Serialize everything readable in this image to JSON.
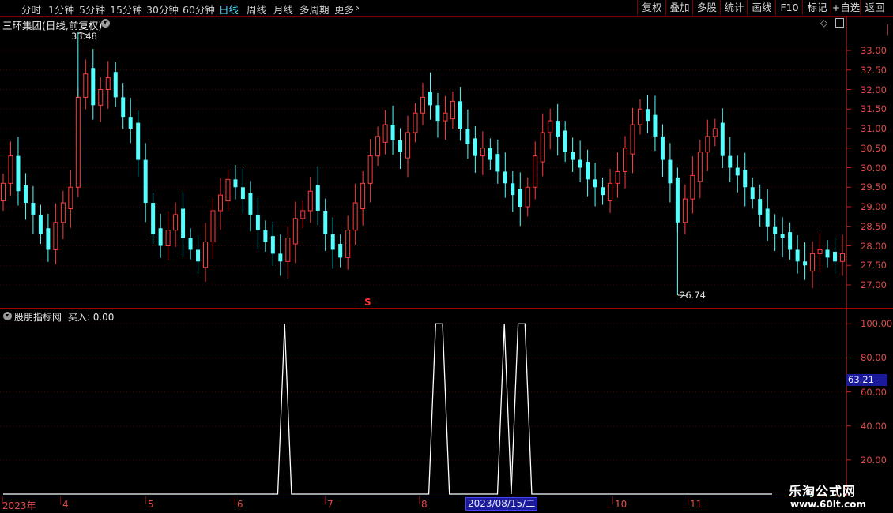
{
  "toolbar": {
    "periods": [
      "分时",
      "1分钟",
      "5分钟",
      "15分钟",
      "30分钟",
      "60分钟",
      "日线",
      "周线",
      "月线",
      "多周期",
      "更多"
    ],
    "active_period": "日线",
    "buttons": [
      "复权",
      "叠加",
      "多股",
      "统计",
      "画线",
      "F10",
      "标记",
      "+自选",
      "返回"
    ]
  },
  "main_chart": {
    "title": "三环集团(日线,前复权)",
    "high_label": "33.48",
    "low_label": "26.74",
    "signal_mark": "S"
  },
  "indicator": {
    "title": "股朋指标网",
    "buy_label": "买入: 0.00",
    "current_value": "63.21"
  },
  "x_axis": {
    "labels": [
      "2023年",
      "4",
      "5",
      "6",
      "7",
      "8",
      "9",
      "10",
      "11"
    ],
    "cursor_date": "2023/08/15/二"
  },
  "watermark": {
    "line1": "乐淘公式网",
    "line2": "www.60lt.com"
  },
  "colors": {
    "up": "#ff3c3c",
    "down": "#54ffff",
    "grid": "#8b0000",
    "axis_text": "#e04b4b",
    "active_tab": "#53e0ff"
  },
  "chart_data": [
    {
      "type": "candlestick",
      "title": "三环集团(日线,前复权)",
      "y_ticks": [
        27.0,
        27.5,
        28.0,
        28.5,
        29.0,
        29.5,
        30.0,
        30.5,
        31.0,
        31.5,
        32.0,
        32.5,
        33.0
      ],
      "ylim": [
        26.5,
        33.6
      ],
      "x_labels": [
        "2023年",
        "4",
        "5",
        "6",
        "7",
        "8",
        "9",
        "10",
        "11"
      ],
      "annotations": [
        {
          "label": "33.48",
          "value": 33.48
        },
        {
          "label": "26.74",
          "value": 26.74
        }
      ],
      "closes": [
        29.6,
        30.3,
        29.4,
        29.1,
        28.8,
        28.3,
        27.9,
        28.6,
        29.1,
        29.5,
        31.8,
        32.4,
        31.6,
        32.0,
        32.3,
        31.8,
        31.3,
        31.0,
        30.2,
        29.1,
        28.3,
        28.0,
        28.4,
        28.8,
        28.2,
        27.9,
        27.6,
        28.1,
        28.9,
        29.3,
        29.7,
        29.5,
        29.2,
        28.8,
        28.4,
        28.1,
        27.8,
        27.6,
        28.2,
        28.7,
        28.9,
        29.4,
        28.9,
        28.3,
        27.9,
        27.7,
        28.4,
        29.1,
        29.6,
        30.3,
        30.8,
        31.1,
        30.7,
        30.4,
        30.9,
        31.4,
        31.8,
        31.6,
        31.2,
        31.4,
        31.7,
        31.0,
        30.6,
        30.3,
        30.5,
        30.2,
        29.9,
        29.6,
        29.3,
        29.0,
        29.5,
        30.3,
        30.9,
        31.2,
        30.8,
        30.4,
        30.2,
        30.0,
        29.7,
        29.5,
        29.3,
        29.6,
        29.9,
        30.5,
        31.1,
        31.5,
        31.2,
        30.8,
        30.2,
        29.6,
        28.6,
        29.2,
        29.8,
        30.4,
        30.8,
        31.0,
        30.3,
        30.0,
        29.8,
        29.5,
        29.2,
        28.8,
        28.5,
        28.3,
        28.2,
        27.9,
        27.6,
        27.5,
        27.8,
        27.9,
        27.7,
        27.6,
        27.8
      ]
    },
    {
      "type": "line",
      "title": "股朋指标网",
      "y_ticks": [
        20.0,
        40.0,
        60.0,
        80.0,
        100.0
      ],
      "ylim": [
        0,
        105
      ],
      "series": [
        {
          "name": "买入",
          "values": [
            0,
            0,
            0,
            0,
            0,
            0,
            0,
            0,
            0,
            0,
            0,
            0,
            0,
            0,
            0,
            0,
            0,
            0,
            0,
            0,
            0,
            0,
            0,
            0,
            0,
            0,
            0,
            0,
            0,
            0,
            0,
            0,
            0,
            0,
            0,
            0,
            0,
            0,
            0,
            0,
            0,
            100,
            0,
            0,
            0,
            0,
            0,
            0,
            0,
            0,
            0,
            0,
            0,
            0,
            0,
            0,
            0,
            0,
            0,
            0,
            0,
            0,
            0,
            100,
            100,
            0,
            0,
            0,
            0,
            0,
            0,
            0,
            0,
            100,
            0,
            100,
            100,
            0,
            0,
            0,
            0,
            0,
            0,
            0,
            0,
            0,
            0,
            0,
            0,
            0,
            0,
            0,
            0,
            0,
            0,
            0,
            0,
            0,
            0,
            0,
            0,
            0,
            0,
            0,
            0,
            0,
            0,
            0,
            0,
            0,
            0,
            0,
            0
          ]
        }
      ]
    }
  ]
}
